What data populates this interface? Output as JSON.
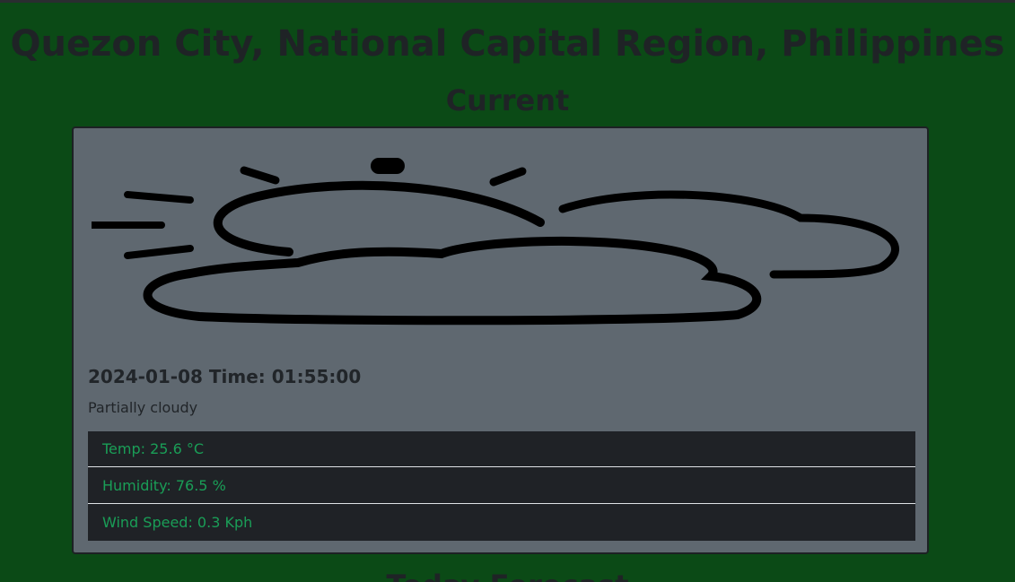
{
  "location": "Quezon City, National Capital Region, Philippines",
  "current_heading": "Current",
  "next_heading": "Today Forecast",
  "current": {
    "date_time": "2024-01-08 Time: 01:55:00",
    "condition": "Partially cloudy",
    "icon": "partly-cloudy-icon",
    "stats": {
      "temp": "Temp: 25.6 °C",
      "humidity": "Humidity: 76.5 %",
      "wind": "Wind Speed: 0.3 Kph"
    }
  },
  "colors": {
    "background": "#0b4a16",
    "card": "#5f6870",
    "stat_row_bg": "#1f2226",
    "stat_text": "#1a9e57"
  }
}
